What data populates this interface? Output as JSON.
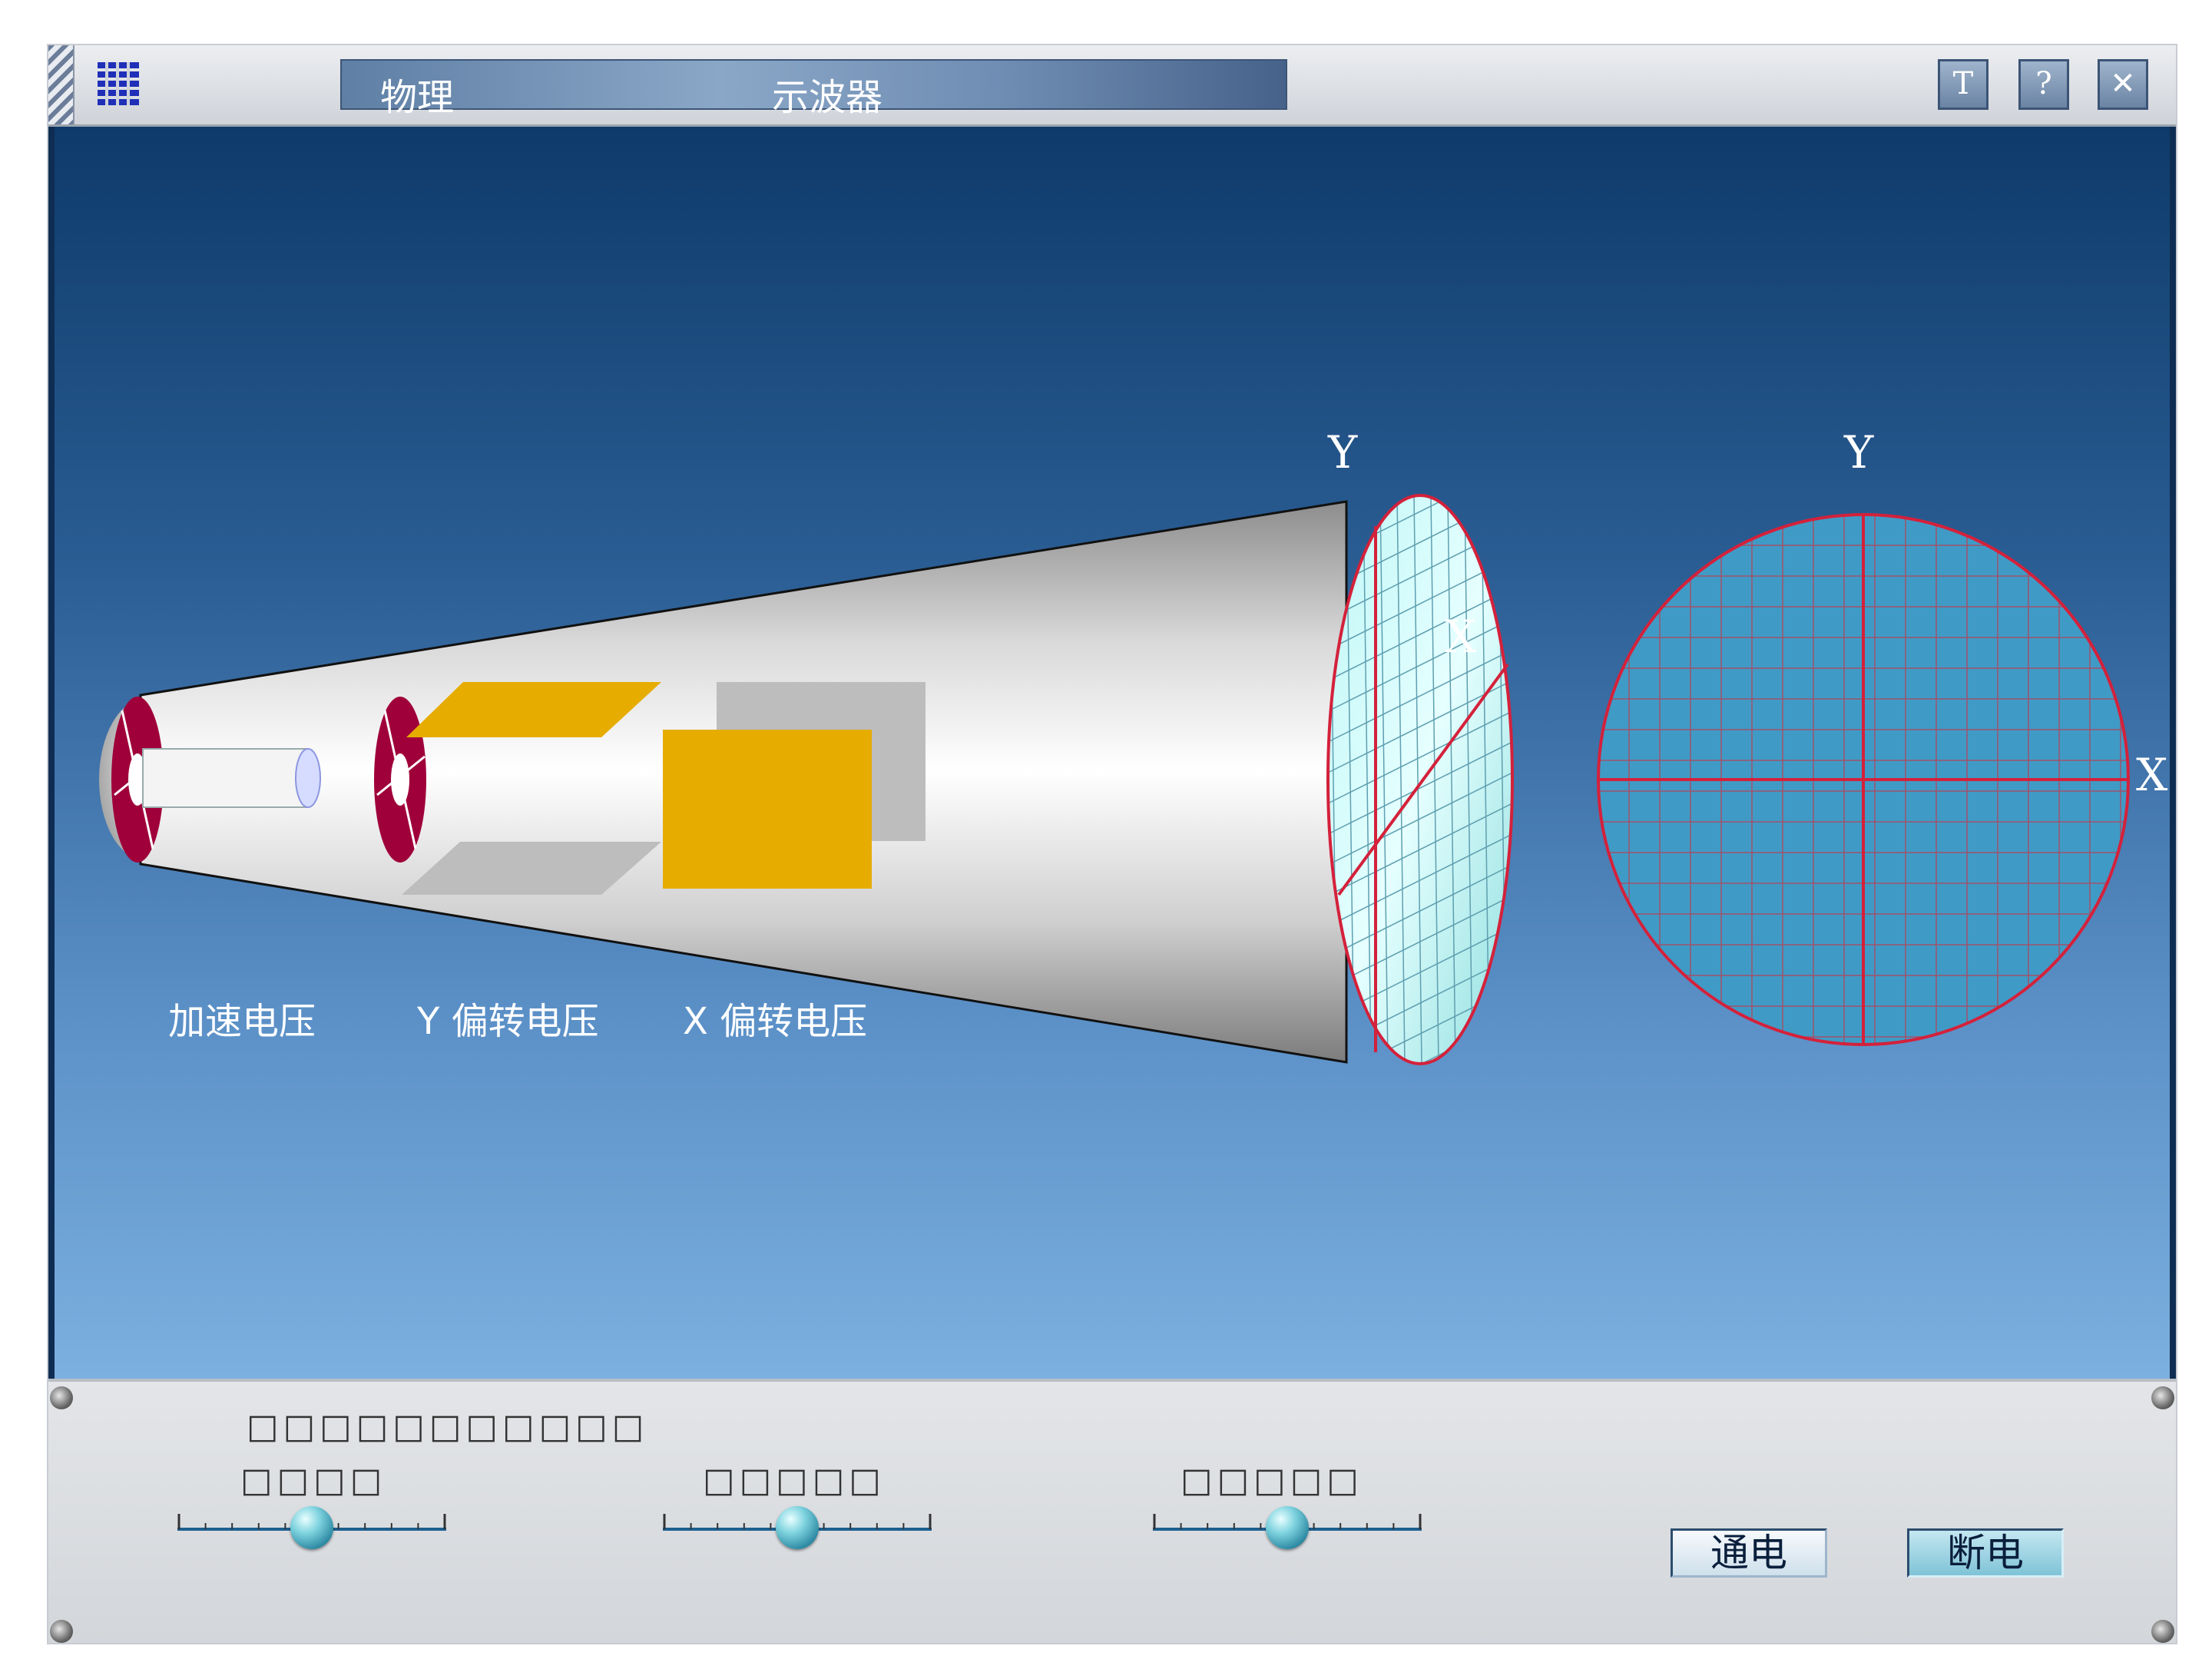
{
  "window": {
    "title_left": "物理",
    "title_right": "示波器",
    "buttons": {
      "text_mode": "T",
      "help": "?",
      "close": "✕"
    }
  },
  "scene": {
    "tube_labels": {
      "accel": "加速电压",
      "y_deflect": "Y 偏转电压",
      "x_deflect": "X 偏转电压"
    },
    "tube_axes": {
      "y": "Y",
      "x": "X"
    },
    "screen_axes": {
      "y": "Y",
      "x": "X"
    },
    "colors": {
      "plates": "#e6ac00",
      "rings": "#a0003a",
      "screen": "#3f9bc6",
      "gridlines": "#d4213b"
    }
  },
  "controls": {
    "panel_title": "□□□□□□□□□□□",
    "sliders": [
      {
        "label": "□□□□",
        "position": 0.5
      },
      {
        "label": "□□□□□",
        "position": 0.5
      },
      {
        "label": "□□□□□",
        "position": 0.5
      }
    ],
    "power_on": "通电",
    "power_off": "断电"
  }
}
